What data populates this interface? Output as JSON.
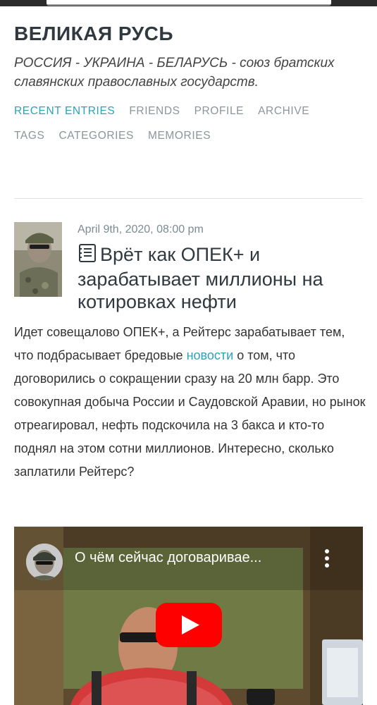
{
  "blog": {
    "title": "ВЕЛИКАЯ РУСЬ",
    "subtitle": "РОССИЯ - УКРАИНА - БЕЛАРУСЬ - союз братских славянских православных государств."
  },
  "nav": {
    "row1": [
      "RECENT ENTRIES",
      "FRIENDS",
      "PROFILE",
      "ARCHIVE"
    ],
    "row2": [
      "TAGS",
      "CATEGORIES",
      "MEMORIES"
    ],
    "active": "RECENT ENTRIES"
  },
  "post": {
    "date": "April 9th, 2020, 08:00 pm",
    "title": "Врёт как ОПЕК+ и зарабатывает миллионы на котировках нефти",
    "body_part1": "Идет совещалово ОПЕК+, а Рейтерс зарабатывает тем, что подбрасывает бредовые ",
    "body_link": "новости",
    "body_part2": " о том, что договорились о сокращении сразу на 20 млн барр. Это совокупная добыча России и Саудовской Аравии, но рынок отреагировал, нефть подскочила на 3 бакса и кто-то поднял на этом сотни миллионов. Интересно, сколько заплатили Рейтерс?"
  },
  "video": {
    "title": "О чём сейчас договаривае..."
  },
  "colors": {
    "accent": "#2aa3b8",
    "nav": "#8b959a",
    "title": "#30393f",
    "play_button": "#ff0000"
  },
  "icons": {
    "post_type": "document-icon",
    "video_play": "play-icon",
    "video_menu": "kebab-menu-icon"
  }
}
